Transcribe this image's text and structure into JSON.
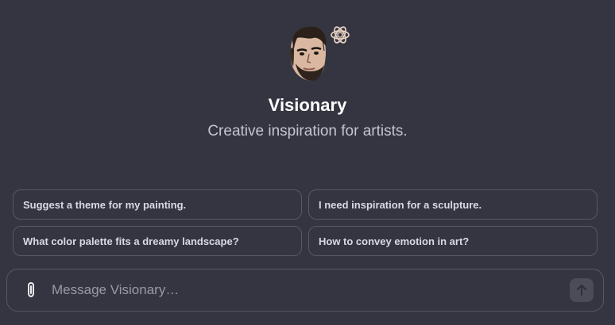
{
  "gpt": {
    "name": "Visionary",
    "description": "Creative inspiration for artists.",
    "avatar_icon": "portrait-avatar",
    "brand_icon": "openai-logo-icon"
  },
  "suggestions": [
    {
      "label": "Suggest a theme for my painting."
    },
    {
      "label": "I need inspiration for a sculpture."
    },
    {
      "label": "What color palette fits a dreamy landscape?"
    },
    {
      "label": "How to convey emotion in art?"
    }
  ],
  "composer": {
    "placeholder": "Message Visionary…",
    "attach_icon": "paperclip-icon",
    "send_icon": "arrow-up-icon"
  },
  "colors": {
    "background": "#343541",
    "border": "#565869",
    "text_primary": "#ffffff",
    "text_secondary": "#c5c5d2",
    "brand_icon": "#e8d2c3"
  }
}
